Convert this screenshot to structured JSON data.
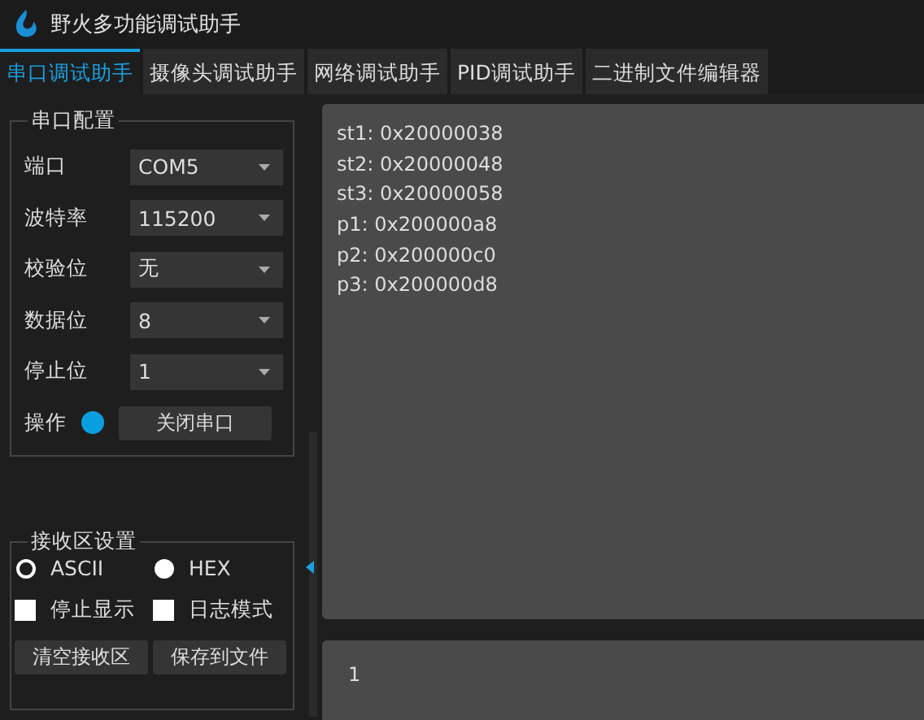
{
  "window": {
    "title": "野火多功能调试助手"
  },
  "tabs": [
    {
      "label": "串口调试助手",
      "selected": true
    },
    {
      "label": "摄像头调试助手",
      "selected": false
    },
    {
      "label": "网络调试助手",
      "selected": false
    },
    {
      "label": "PID调试助手",
      "selected": false
    },
    {
      "label": "二进制文件编辑器",
      "selected": false
    }
  ],
  "serial_config": {
    "title": "串口配置",
    "fields": [
      {
        "label": "端口",
        "value": "COM5"
      },
      {
        "label": "波特率",
        "value": "115200"
      },
      {
        "label": "校验位",
        "value": "无"
      },
      {
        "label": "数据位",
        "value": "8"
      },
      {
        "label": "停止位",
        "value": "1"
      }
    ],
    "operation": {
      "label": "操作",
      "status_light": {
        "color": "#0a9ee0"
      },
      "button": "关闭串口"
    }
  },
  "receive_settings": {
    "title": "接收区设置",
    "radios": [
      {
        "label": "ASCII",
        "selected": true
      },
      {
        "label": "HEX",
        "selected": false
      }
    ],
    "checkboxes": [
      {
        "label": "停止显示",
        "checked": false
      },
      {
        "label": "日志模式",
        "checked": false
      }
    ],
    "buttons": [
      "清空接收区",
      "保存到文件"
    ]
  },
  "receive_area": {
    "lines": [
      "st1: 0x20000038",
      "st2: 0x20000048",
      "st3: 0x20000058",
      "p1: 0x200000a8",
      "p2: 0x200000c0",
      "p3: 0x200000d8"
    ]
  },
  "send_area": {
    "value": "1"
  }
}
